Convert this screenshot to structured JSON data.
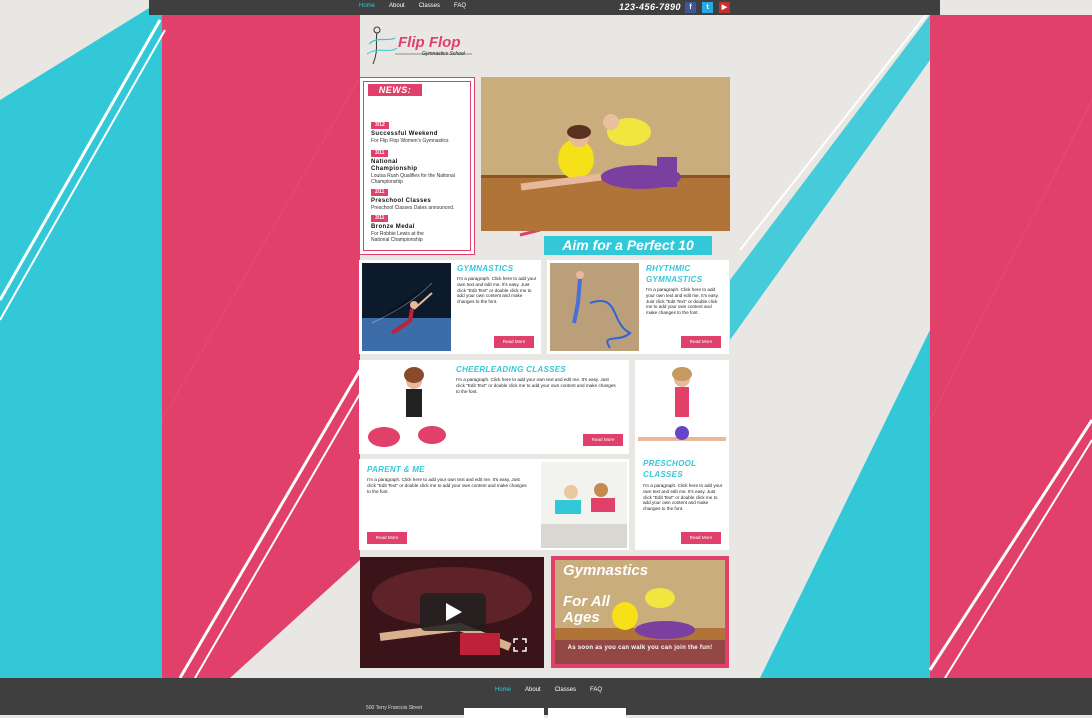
{
  "nav": {
    "items": [
      "Home",
      "About",
      "Classes",
      "FAQ"
    ],
    "active": "Home"
  },
  "header": {
    "phone": "123-456-7890",
    "social": [
      {
        "icon": "facebook-icon",
        "glyph": "f",
        "color": "#3b5998"
      },
      {
        "icon": "twitter-icon",
        "glyph": "t",
        "color": "#2aa9e0"
      },
      {
        "icon": "youtube-icon",
        "glyph": "▶",
        "color": "#c4302b"
      }
    ]
  },
  "logo": {
    "title": "Flip Flop",
    "subtitle": "Gymnastics School"
  },
  "news": {
    "heading": "NEWS:",
    "items": [
      {
        "date": "3/12",
        "title": "Successful Weekend",
        "text": "For Flip Flop Women's Gymnastics"
      },
      {
        "date": "3/11",
        "title": "National Championship",
        "text": "Louisa Rush Qualifies for the National Championship"
      },
      {
        "date": "2/11",
        "title": "Preschool Classes",
        "text": "Preschool Classes Dates announced."
      },
      {
        "date": "3/11",
        "title": "Bronze Medal",
        "text": "For Robbie Lewis at the National Championship"
      }
    ]
  },
  "banner": {
    "tagline": "Aim for a Perfect 10"
  },
  "cards": {
    "gymnastics": {
      "title": "GYMNASTICS",
      "text": "I'm a paragraph. Click here to add your own text and edit me. It's easy. Just click \"Edit Text\" or double click me to add your own content and make changes to the font.",
      "button": "Read More"
    },
    "rhythmic": {
      "title": "RHYTHMIC GYMNASTICS",
      "text": "I'm a paragraph. Click here to add your own text and edit me. It's easy. Just click \"Edit Text\" or double click me to add your own content and make changes to the font.",
      "button": "Read More"
    },
    "cheer": {
      "title": "CHEERLEADING CLASSES",
      "text": "I'm a paragraph. Click here to add your own text and edit me. It's easy. Just click \"Edit Text\" or double click me to add your own content and make changes to the font.",
      "button": "Read More"
    },
    "preschool": {
      "title": "PRESCHOOL CLASSES",
      "text": "I'm a paragraph. Click here to add your own text and edit me. It's easy. Just click \"Edit Text\" or double click me to add your own content and make changes to the font.",
      "button": "Read More"
    },
    "parent": {
      "title": "PARENT & ME",
      "text": "I'm a paragraph. Click here to add your own text and edit me. It's easy. Just click \"Edit Text\" or double click me to add your own content and make changes to the font.",
      "button": "Read More"
    }
  },
  "promo": {
    "line1": "Gymnastics",
    "line2": "For All Ages",
    "line3": "As soon as you can walk you can join the fun!"
  },
  "footer": {
    "nav": [
      "Home",
      "About",
      "Classes",
      "FAQ"
    ],
    "address": "500 Terry Francois Street"
  },
  "colors": {
    "pink": "#e0406a",
    "cyan": "#33c8d8",
    "dark": "#3f3f3f"
  }
}
